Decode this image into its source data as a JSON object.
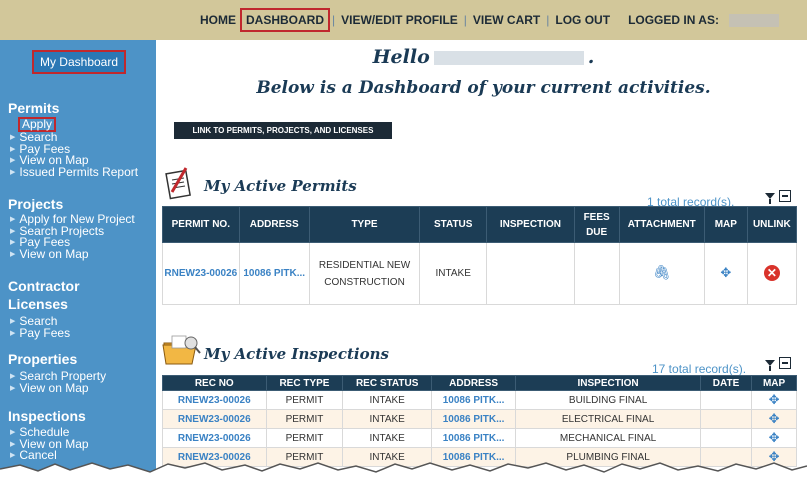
{
  "nav": {
    "home": "HOME",
    "dashboard": "DASHBOARD",
    "view_edit_profile": "VIEW/EDIT PROFILE",
    "view_cart": "VIEW CART",
    "logout": "LOG OUT",
    "logged_in_as": "LOGGED IN AS:",
    "separator": "|"
  },
  "sidebar": {
    "dashboard_button": "My Dashboard",
    "sections": [
      {
        "title": "Permits",
        "items": [
          "Apply",
          "Search",
          "Pay Fees",
          "View on Map",
          "Issued Permits Report"
        ]
      },
      {
        "title": "Projects",
        "items": [
          "Apply for New Project",
          "Search Projects",
          "Pay Fees",
          "View on Map"
        ]
      },
      {
        "title": "Contractor",
        "title2": "Licenses",
        "items": [
          "Search",
          "Pay Fees"
        ]
      },
      {
        "title": "Properties",
        "items": [
          "Search Property",
          "View on Map"
        ]
      },
      {
        "title": "Inspections",
        "items": [
          "Schedule",
          "View on Map",
          "Cancel"
        ]
      }
    ]
  },
  "main": {
    "hello": "Hello",
    "hello_end": ".",
    "subtitle": "Below is a Dashboard of your current activities.",
    "link_button": "LINK TO PERMITS, PROJECTS, AND LICENSES"
  },
  "permits": {
    "title": "My Active Permits",
    "record_count": "1 total record(s).",
    "headers": [
      "PERMIT NO.",
      "ADDRESS",
      "TYPE",
      "STATUS",
      "INSPECTION",
      "FEES DUE",
      "ATTACHMENT",
      "MAP",
      "UNLINK"
    ],
    "rows": [
      {
        "permit_no": "RNEW23-00026",
        "address": "10086 PITK...",
        "type": "RESIDENTIAL NEW CONSTRUCTION",
        "status": "INTAKE",
        "inspection": "",
        "fees_due": ""
      }
    ]
  },
  "inspections": {
    "title": "My Active Inspections",
    "record_count": "17 total record(s).",
    "headers": [
      "REC NO",
      "REC TYPE",
      "REC STATUS",
      "ADDRESS",
      "INSPECTION",
      "DATE",
      "MAP"
    ],
    "rows": [
      {
        "rec_no": "RNEW23-00026",
        "rec_type": "PERMIT",
        "rec_status": "INTAKE",
        "address": "10086 PITK...",
        "inspection": "BUILDING FINAL",
        "date": ""
      },
      {
        "rec_no": "RNEW23-00026",
        "rec_type": "PERMIT",
        "rec_status": "INTAKE",
        "address": "10086 PITK...",
        "inspection": "ELECTRICAL FINAL",
        "date": ""
      },
      {
        "rec_no": "RNEW23-00026",
        "rec_type": "PERMIT",
        "rec_status": "INTAKE",
        "address": "10086 PITK...",
        "inspection": "MECHANICAL FINAL",
        "date": ""
      },
      {
        "rec_no": "RNEW23-00026",
        "rec_type": "PERMIT",
        "rec_status": "INTAKE",
        "address": "10086 PITK...",
        "inspection": "PLUMBING FINAL",
        "date": ""
      }
    ]
  },
  "colors": {
    "nav_bg": "#d2c79a",
    "sidebar_bg": "#4d93c7",
    "header_dark": "#1c3d55",
    "highlight": "#c0282d",
    "link": "#3a82c4"
  }
}
